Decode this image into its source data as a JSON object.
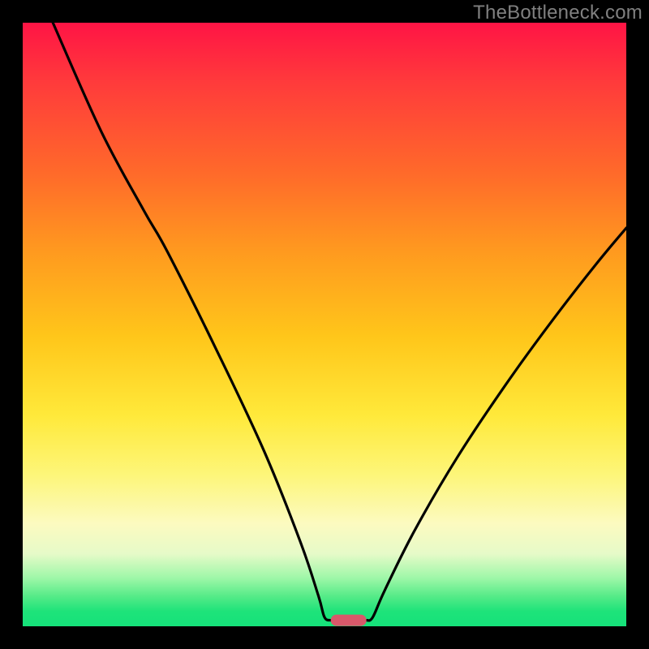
{
  "watermark": "TheBottleneck.com",
  "colors": {
    "frame": "#000000",
    "watermark": "#808080",
    "curve": "#000000",
    "marker": "#d8586a",
    "gradient_stops": [
      {
        "pos": 0.0,
        "color": "#ff1445"
      },
      {
        "pos": 0.1,
        "color": "#ff3b3b"
      },
      {
        "pos": 0.25,
        "color": "#ff6a2a"
      },
      {
        "pos": 0.38,
        "color": "#ff9a1f"
      },
      {
        "pos": 0.52,
        "color": "#ffc61a"
      },
      {
        "pos": 0.65,
        "color": "#ffe93a"
      },
      {
        "pos": 0.75,
        "color": "#fdf67a"
      },
      {
        "pos": 0.83,
        "color": "#fcfac0"
      },
      {
        "pos": 0.88,
        "color": "#e6fac8"
      },
      {
        "pos": 0.92,
        "color": "#9ef7a8"
      },
      {
        "pos": 0.95,
        "color": "#56eb88"
      },
      {
        "pos": 0.975,
        "color": "#1ee37a"
      },
      {
        "pos": 1.0,
        "color": "#15e27a"
      }
    ]
  },
  "chart_data": {
    "type": "line",
    "title": "",
    "xlabel": "",
    "ylabel": "",
    "xlim": [
      0,
      100
    ],
    "ylim": [
      0,
      100
    ],
    "grid": false,
    "legend": false,
    "curve_left": {
      "description": "left descending branch from top-left toward valley",
      "points": [
        {
          "x": 5,
          "y": 100
        },
        {
          "x": 13,
          "y": 82
        },
        {
          "x": 20,
          "y": 69
        },
        {
          "x": 24,
          "y": 62
        },
        {
          "x": 32,
          "y": 46
        },
        {
          "x": 40,
          "y": 29
        },
        {
          "x": 46,
          "y": 14
        },
        {
          "x": 49,
          "y": 5
        },
        {
          "x": 50,
          "y": 1.5
        },
        {
          "x": 51,
          "y": 1
        }
      ]
    },
    "curve_right": {
      "description": "right ascending branch from valley toward upper-right",
      "points": [
        {
          "x": 57,
          "y": 1
        },
        {
          "x": 58,
          "y": 1.5
        },
        {
          "x": 60,
          "y": 6
        },
        {
          "x": 65,
          "y": 16
        },
        {
          "x": 72,
          "y": 28
        },
        {
          "x": 80,
          "y": 40
        },
        {
          "x": 88,
          "y": 51
        },
        {
          "x": 95,
          "y": 60
        },
        {
          "x": 100,
          "y": 66
        }
      ]
    },
    "marker": {
      "description": "rounded pill at the valley minimum on the baseline",
      "x": 54,
      "y": 1,
      "width_pct": 6,
      "height_pct": 2
    }
  }
}
